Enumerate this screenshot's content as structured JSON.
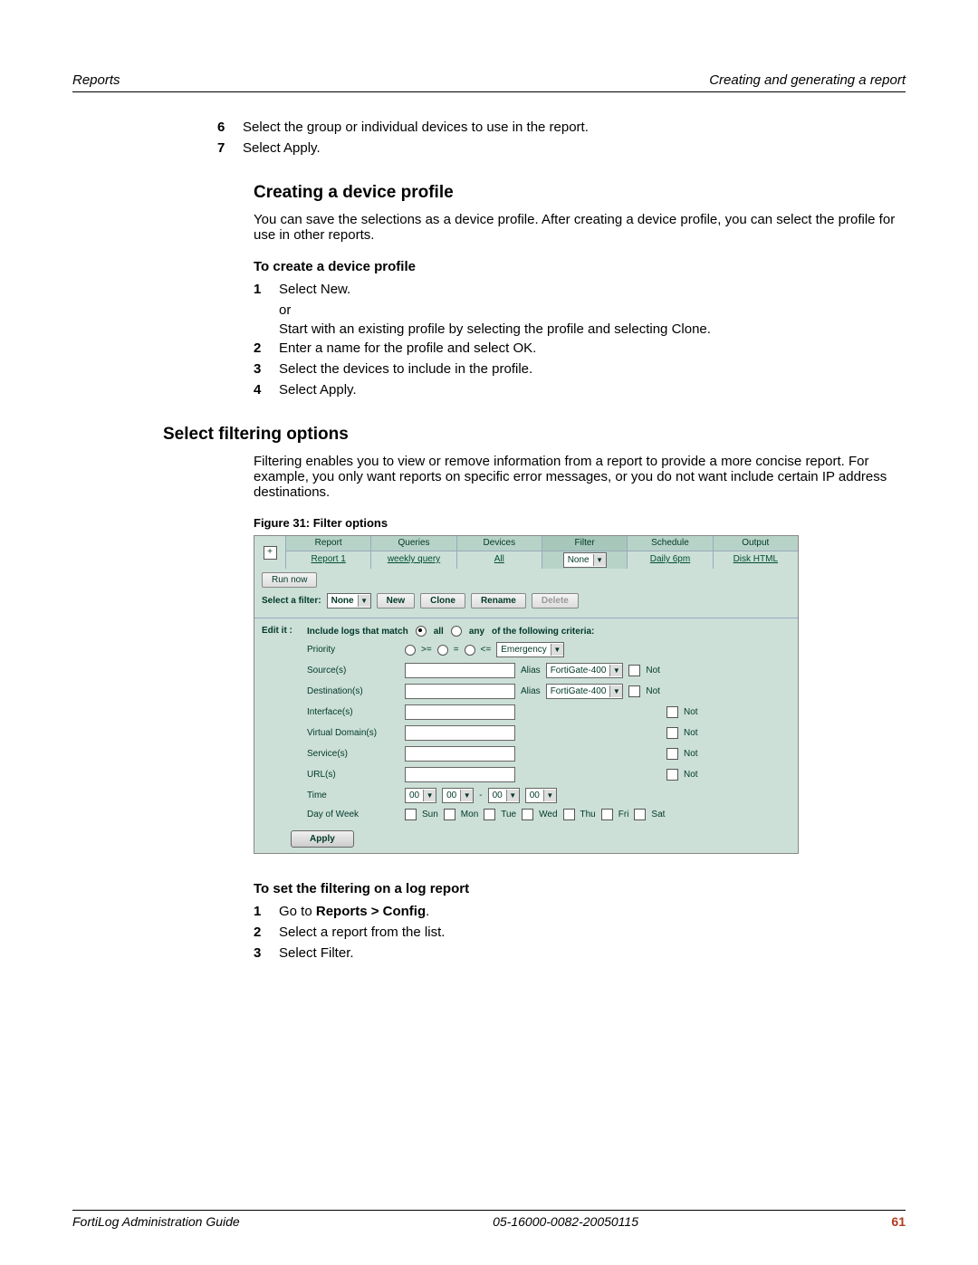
{
  "header": {
    "left": "Reports",
    "right": "Creating and generating a report"
  },
  "prev_steps": [
    {
      "n": "6",
      "t": "Select the group or individual devices to use in the report."
    },
    {
      "n": "7",
      "t": "Select Apply."
    }
  ],
  "sec1": {
    "title": "Creating a device profile",
    "para": "You can save the selections as a device profile. After creating a device profile, you can select the profile for use in other reports.",
    "subhead": "To create a device profile",
    "steps": [
      {
        "n": "1",
        "t": "Select New.",
        "t2": "or",
        "t3": "Start with an existing profile by selecting the profile and selecting Clone."
      },
      {
        "n": "2",
        "t": "Enter a name for the profile and select OK."
      },
      {
        "n": "3",
        "t": "Select the devices to include in the profile."
      },
      {
        "n": "4",
        "t": "Select Apply."
      }
    ]
  },
  "sec2": {
    "title": "Select filtering options",
    "para": "Filtering enables you to view or remove information from a report to provide a more concise report. For example, you only want reports on specific error messages, or you do not want include certain IP address destinations.",
    "figcap": "Figure 31: Filter options"
  },
  "figure": {
    "expand_icon": "+",
    "tabs": [
      {
        "head": "Report",
        "val": "Report 1",
        "link": true
      },
      {
        "head": "Queries",
        "val": "weekly query",
        "link": true
      },
      {
        "head": "Devices",
        "val": "All",
        "link": true
      },
      {
        "head": "Filter",
        "val": "None",
        "select": true
      },
      {
        "head": "Schedule",
        "val": "Daily 6pm",
        "link": true
      },
      {
        "head": "Output",
        "val": "Disk HTML",
        "link": true
      }
    ],
    "run_now": "Run now",
    "selectfilter_label": "Select a filter:",
    "filter_value": "None",
    "buttons": {
      "new": "New",
      "clone": "Clone",
      "rename": "Rename",
      "delete": "Delete"
    },
    "edit_label": "Edit it :",
    "match_prefix": "Include logs that match",
    "match_all": "all",
    "match_any": "any",
    "match_suffix": "of the following criteria:",
    "rows": {
      "priority": "Priority",
      "priority_ops": {
        "ge": ">=",
        "eq": "=",
        "le": "<="
      },
      "priority_val": "Emergency",
      "sources": "Source(s)",
      "dest": "Destination(s)",
      "alias": "Alias",
      "alias_val": "FortiGate-400",
      "not": "Not",
      "interfaces": "Interface(s)",
      "vdoms": "Virtual Domain(s)",
      "services": "Service(s)",
      "urls": "URL(s)",
      "time": "Time",
      "time_sep": "-",
      "time_val": "00",
      "dow": "Day of Week",
      "days": [
        "Sun",
        "Mon",
        "Tue",
        "Wed",
        "Thu",
        "Fri",
        "Sat"
      ]
    },
    "apply": "Apply"
  },
  "sec3": {
    "subhead": "To set the filtering on a log report",
    "steps": [
      {
        "n": "1",
        "pre": "Go to ",
        "bold": "Reports > Config",
        "post": "."
      },
      {
        "n": "2",
        "t": "Select a report from the list."
      },
      {
        "n": "3",
        "t": "Select Filter."
      }
    ]
  },
  "footer": {
    "left": "FortiLog Administration Guide",
    "mid": "05-16000-0082-20050115",
    "page": "61"
  }
}
